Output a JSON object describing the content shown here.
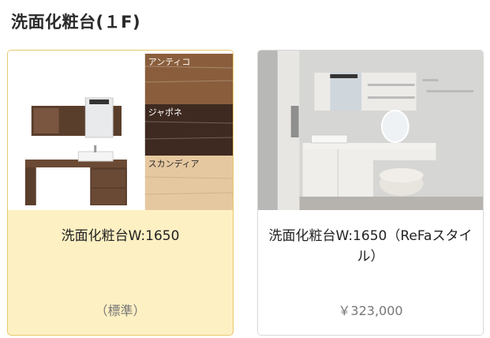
{
  "page": {
    "title": "洗面化粧台(１F)"
  },
  "options": [
    {
      "name": "洗面化粧台W:1650",
      "price": "（標準）",
      "selected": true,
      "swatches": [
        "アンティコ",
        "ジャポネ",
        "スカンディア"
      ]
    },
    {
      "name": "洗面化粧台W:1650（ReFaスタイル）",
      "price": "￥323,000",
      "selected": false
    }
  ],
  "colors": {
    "selected_bg": "#fdf0c3",
    "selected_border": "#e7c86a",
    "price_text": "#777777"
  }
}
